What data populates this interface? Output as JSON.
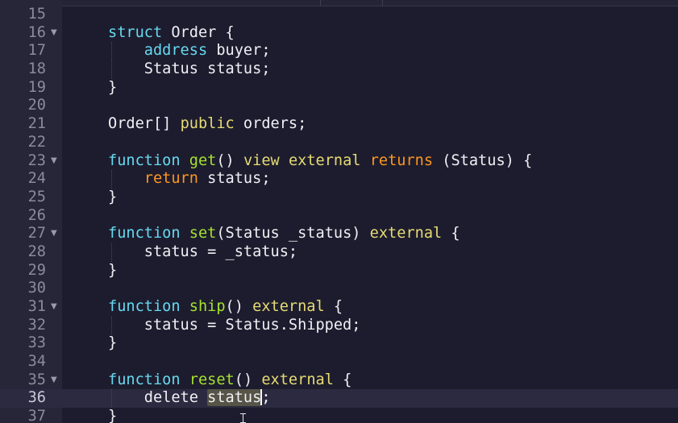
{
  "editor": {
    "colors": {
      "background": "#1d1c2e",
      "gutter": "#272638",
      "active_line": "#2b2a40",
      "keyword": "#66d9ef",
      "function_name": "#a6e22e",
      "modifier": "#e6db74",
      "return_keyword": "#fd971f",
      "text": "#f0f0f5",
      "selection_highlight": "#555447"
    },
    "active_line_number": "36",
    "lines": [
      {
        "num": "15",
        "fold": false,
        "tokens": []
      },
      {
        "num": "16",
        "fold": true,
        "tokens": [
          {
            "t": "struct",
            "c": "kw"
          },
          {
            "t": " Order {",
            "c": "plain"
          }
        ]
      },
      {
        "num": "17",
        "fold": false,
        "tokens": [
          {
            "t": "    ",
            "c": "plain"
          },
          {
            "t": "address",
            "c": "kw"
          },
          {
            "t": " buyer;",
            "c": "plain"
          }
        ]
      },
      {
        "num": "18",
        "fold": false,
        "tokens": [
          {
            "t": "    Status status;",
            "c": "plain"
          }
        ]
      },
      {
        "num": "19",
        "fold": false,
        "tokens": [
          {
            "t": "}",
            "c": "plain"
          }
        ]
      },
      {
        "num": "20",
        "fold": false,
        "tokens": []
      },
      {
        "num": "21",
        "fold": false,
        "tokens": [
          {
            "t": "Order[] ",
            "c": "plain"
          },
          {
            "t": "public",
            "c": "mod"
          },
          {
            "t": " orders;",
            "c": "plain"
          }
        ]
      },
      {
        "num": "22",
        "fold": false,
        "tokens": []
      },
      {
        "num": "23",
        "fold": true,
        "tokens": [
          {
            "t": "function",
            "c": "kw"
          },
          {
            "t": " ",
            "c": "plain"
          },
          {
            "t": "get",
            "c": "fn"
          },
          {
            "t": "() ",
            "c": "plain"
          },
          {
            "t": "view",
            "c": "mod"
          },
          {
            "t": " ",
            "c": "plain"
          },
          {
            "t": "external",
            "c": "mod"
          },
          {
            "t": " ",
            "c": "plain"
          },
          {
            "t": "returns",
            "c": "ret"
          },
          {
            "t": " (Status) {",
            "c": "plain"
          }
        ]
      },
      {
        "num": "24",
        "fold": false,
        "tokens": [
          {
            "t": "    ",
            "c": "plain"
          },
          {
            "t": "return",
            "c": "ret"
          },
          {
            "t": " status;",
            "c": "plain"
          }
        ]
      },
      {
        "num": "25",
        "fold": false,
        "tokens": [
          {
            "t": "}",
            "c": "plain"
          }
        ]
      },
      {
        "num": "26",
        "fold": false,
        "tokens": []
      },
      {
        "num": "27",
        "fold": true,
        "tokens": [
          {
            "t": "function",
            "c": "kw"
          },
          {
            "t": " ",
            "c": "plain"
          },
          {
            "t": "set",
            "c": "fn"
          },
          {
            "t": "(Status _status) ",
            "c": "plain"
          },
          {
            "t": "external",
            "c": "mod"
          },
          {
            "t": " {",
            "c": "plain"
          }
        ]
      },
      {
        "num": "28",
        "fold": false,
        "tokens": [
          {
            "t": "    status = _status;",
            "c": "plain"
          }
        ]
      },
      {
        "num": "29",
        "fold": false,
        "tokens": [
          {
            "t": "}",
            "c": "plain"
          }
        ]
      },
      {
        "num": "30",
        "fold": false,
        "tokens": []
      },
      {
        "num": "31",
        "fold": true,
        "tokens": [
          {
            "t": "function",
            "c": "kw"
          },
          {
            "t": " ",
            "c": "plain"
          },
          {
            "t": "ship",
            "c": "fn"
          },
          {
            "t": "() ",
            "c": "plain"
          },
          {
            "t": "external",
            "c": "mod"
          },
          {
            "t": " {",
            "c": "plain"
          }
        ]
      },
      {
        "num": "32",
        "fold": false,
        "tokens": [
          {
            "t": "    status = Status.Shipped;",
            "c": "plain"
          }
        ]
      },
      {
        "num": "33",
        "fold": false,
        "tokens": [
          {
            "t": "}",
            "c": "plain"
          }
        ]
      },
      {
        "num": "34",
        "fold": false,
        "tokens": []
      },
      {
        "num": "35",
        "fold": true,
        "tokens": [
          {
            "t": "function",
            "c": "kw"
          },
          {
            "t": " ",
            "c": "plain"
          },
          {
            "t": "reset",
            "c": "fn"
          },
          {
            "t": "() ",
            "c": "plain"
          },
          {
            "t": "external",
            "c": "mod"
          },
          {
            "t": " {",
            "c": "plain"
          }
        ]
      },
      {
        "num": "36",
        "fold": false,
        "tokens": [
          {
            "t": "    delete ",
            "c": "plain"
          },
          {
            "t": "status",
            "c": "hl"
          },
          {
            "t": "|cursor|",
            "c": "cursor"
          },
          {
            "t": ";",
            "c": "plain"
          }
        ]
      },
      {
        "num": "37",
        "fold": false,
        "tokens": [
          {
            "t": "}",
            "c": "plain"
          }
        ]
      }
    ]
  },
  "icons": {
    "fold": "fold-arrow-icon",
    "pointer": "text-cursor-icon"
  }
}
